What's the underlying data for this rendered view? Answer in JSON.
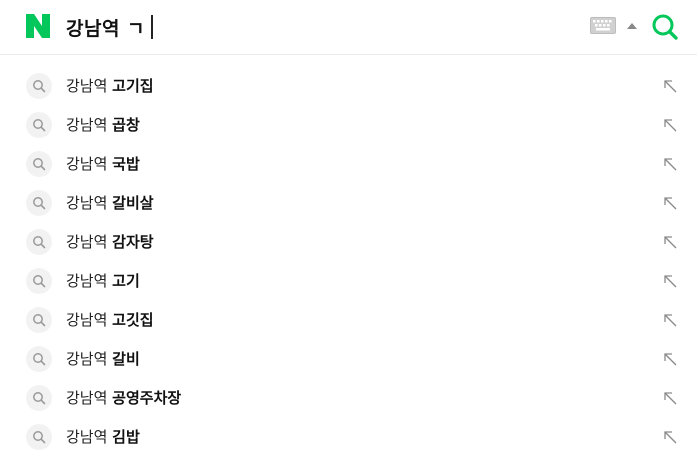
{
  "search": {
    "query": "강남역 ㄱ",
    "brand_color": "#03c75a"
  },
  "icons": {
    "logo": "naver-n-logo",
    "keyboard": "keyboard-icon",
    "toggle": "caret-up-icon",
    "search": "search-icon",
    "suggestion_search": "magnifier-icon",
    "insert_arrow": "arrow-up-left-icon"
  },
  "suggestions": [
    {
      "prefix": "강남역 ",
      "suffix": "고기집"
    },
    {
      "prefix": "강남역 ",
      "suffix": "곱창"
    },
    {
      "prefix": "강남역 ",
      "suffix": "국밥"
    },
    {
      "prefix": "강남역 ",
      "suffix": "갈비살"
    },
    {
      "prefix": "강남역 ",
      "suffix": "감자탕"
    },
    {
      "prefix": "강남역 ",
      "suffix": "고기"
    },
    {
      "prefix": "강남역 ",
      "suffix": "고깃집"
    },
    {
      "prefix": "강남역 ",
      "suffix": "갈비"
    },
    {
      "prefix": "강남역 ",
      "suffix": "공영주차장"
    },
    {
      "prefix": "강남역 ",
      "suffix": "김밥"
    }
  ]
}
